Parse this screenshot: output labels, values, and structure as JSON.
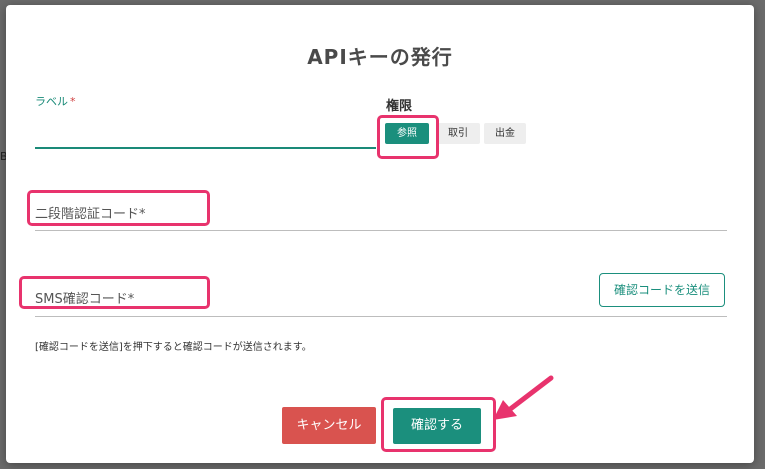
{
  "backdrop": {
    "edge_text": "B"
  },
  "dialog": {
    "title": "APIキーの発行",
    "label_field": {
      "label": "ラベル",
      "required_mark": "*",
      "value": ""
    },
    "permissions": {
      "title": "権限",
      "options": [
        {
          "label": "参照",
          "selected": true
        },
        {
          "label": "取引",
          "selected": false
        },
        {
          "label": "出金",
          "selected": false
        }
      ]
    },
    "two_factor_field": {
      "placeholder": "二段階認証コード*"
    },
    "sms_field": {
      "placeholder": "SMS確認コード*"
    },
    "send_code_button": "確認コードを送信",
    "note": "[確認コードを送信]を押下すると確認コードが送信されます。",
    "cancel_button": "キャンセル",
    "confirm_button": "確認する"
  },
  "colors": {
    "accent": "#1b8f7d",
    "danger": "#d9534f",
    "highlight": "#e8336d"
  }
}
